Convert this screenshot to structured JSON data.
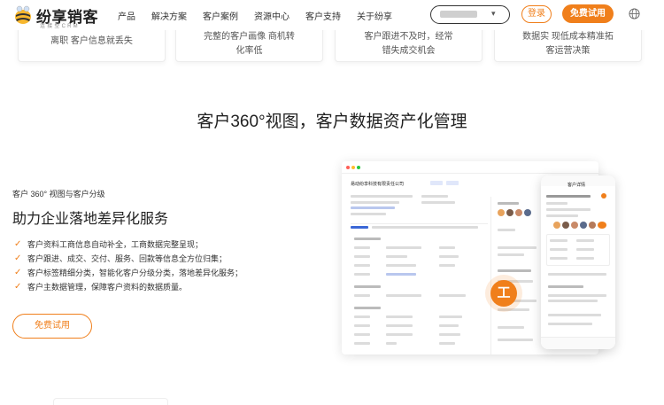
{
  "header": {
    "logo_name": "纷享销客",
    "logo_sub": "连接型CRM",
    "nav": [
      "产品",
      "解决方案",
      "客户案例",
      "资源中心",
      "客户支持",
      "关于纷享"
    ],
    "search_dropdown": "▾",
    "login_label": "登录",
    "trial_label": "免费试用"
  },
  "cards": [
    {
      "lines": [
        "离职 客户信息就丢失"
      ]
    },
    {
      "lines": [
        "完整的客户画像 商机转",
        "化率低"
      ]
    },
    {
      "lines": [
        "客户跟进不及时，经常",
        "错失成交机会"
      ]
    },
    {
      "lines": [
        "数据实 现低成本精准拓",
        "客运营决策"
      ]
    }
  ],
  "section": {
    "title": "客户360°视图，客户数据资产化管理",
    "tag": "客户 360° 视图与客户分级",
    "heading": "助力企业落地差异化服务",
    "features": [
      "客户资料工商信息自动补全，工商数据完整呈现；",
      "客户跟进、成交、交付、服务、回款等信息全方位归集；",
      "客户标签精细分类，智能化客户分级分类，落地差异化服务；",
      "客户主数据管理，保障客户资料的数据质量。"
    ],
    "cta_label": "免费试用"
  },
  "illustration": {
    "company": "易动纷享科技有限责任公司",
    "phone_title": "客户详情",
    "center_icon_char": "工"
  },
  "colors": {
    "accent": "#f07f1b",
    "text": "#222222",
    "muted": "#555555"
  }
}
